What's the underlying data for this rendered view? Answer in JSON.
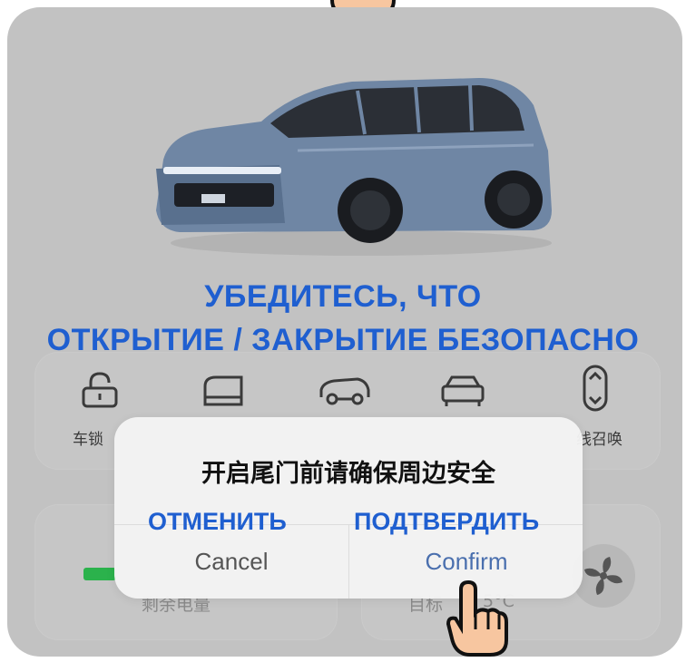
{
  "overlay": {
    "warning_line1": "УБЕДИТЕСЬ, ЧТО",
    "warning_line2": "ОТКРЫТИЕ / ЗАКРЫТИЕ БЕЗОПАСНО",
    "cancel_ru": "ОТМЕНИТЬ",
    "confirm_ru": "ПОДТВЕРДИТЬ",
    "accent_color": "#1f5fd0"
  },
  "controls": {
    "items": [
      {
        "icon": "lock-icon",
        "label": "车锁"
      },
      {
        "icon": "window-icon",
        "label": ""
      },
      {
        "icon": "car-side-icon",
        "label": ""
      },
      {
        "icon": "car-front-icon",
        "label": ""
      },
      {
        "icon": "summon-icon",
        "label": "线召唤"
      }
    ]
  },
  "dialog": {
    "message": "开启尾门前请确保周边安全",
    "cancel_label": "Cancel",
    "confirm_label": "Confirm"
  },
  "status": {
    "battery_label": "剩余电量",
    "temp_label": "目标",
    "temp_unit": "5°C",
    "battery_color": "#2bb24c"
  }
}
